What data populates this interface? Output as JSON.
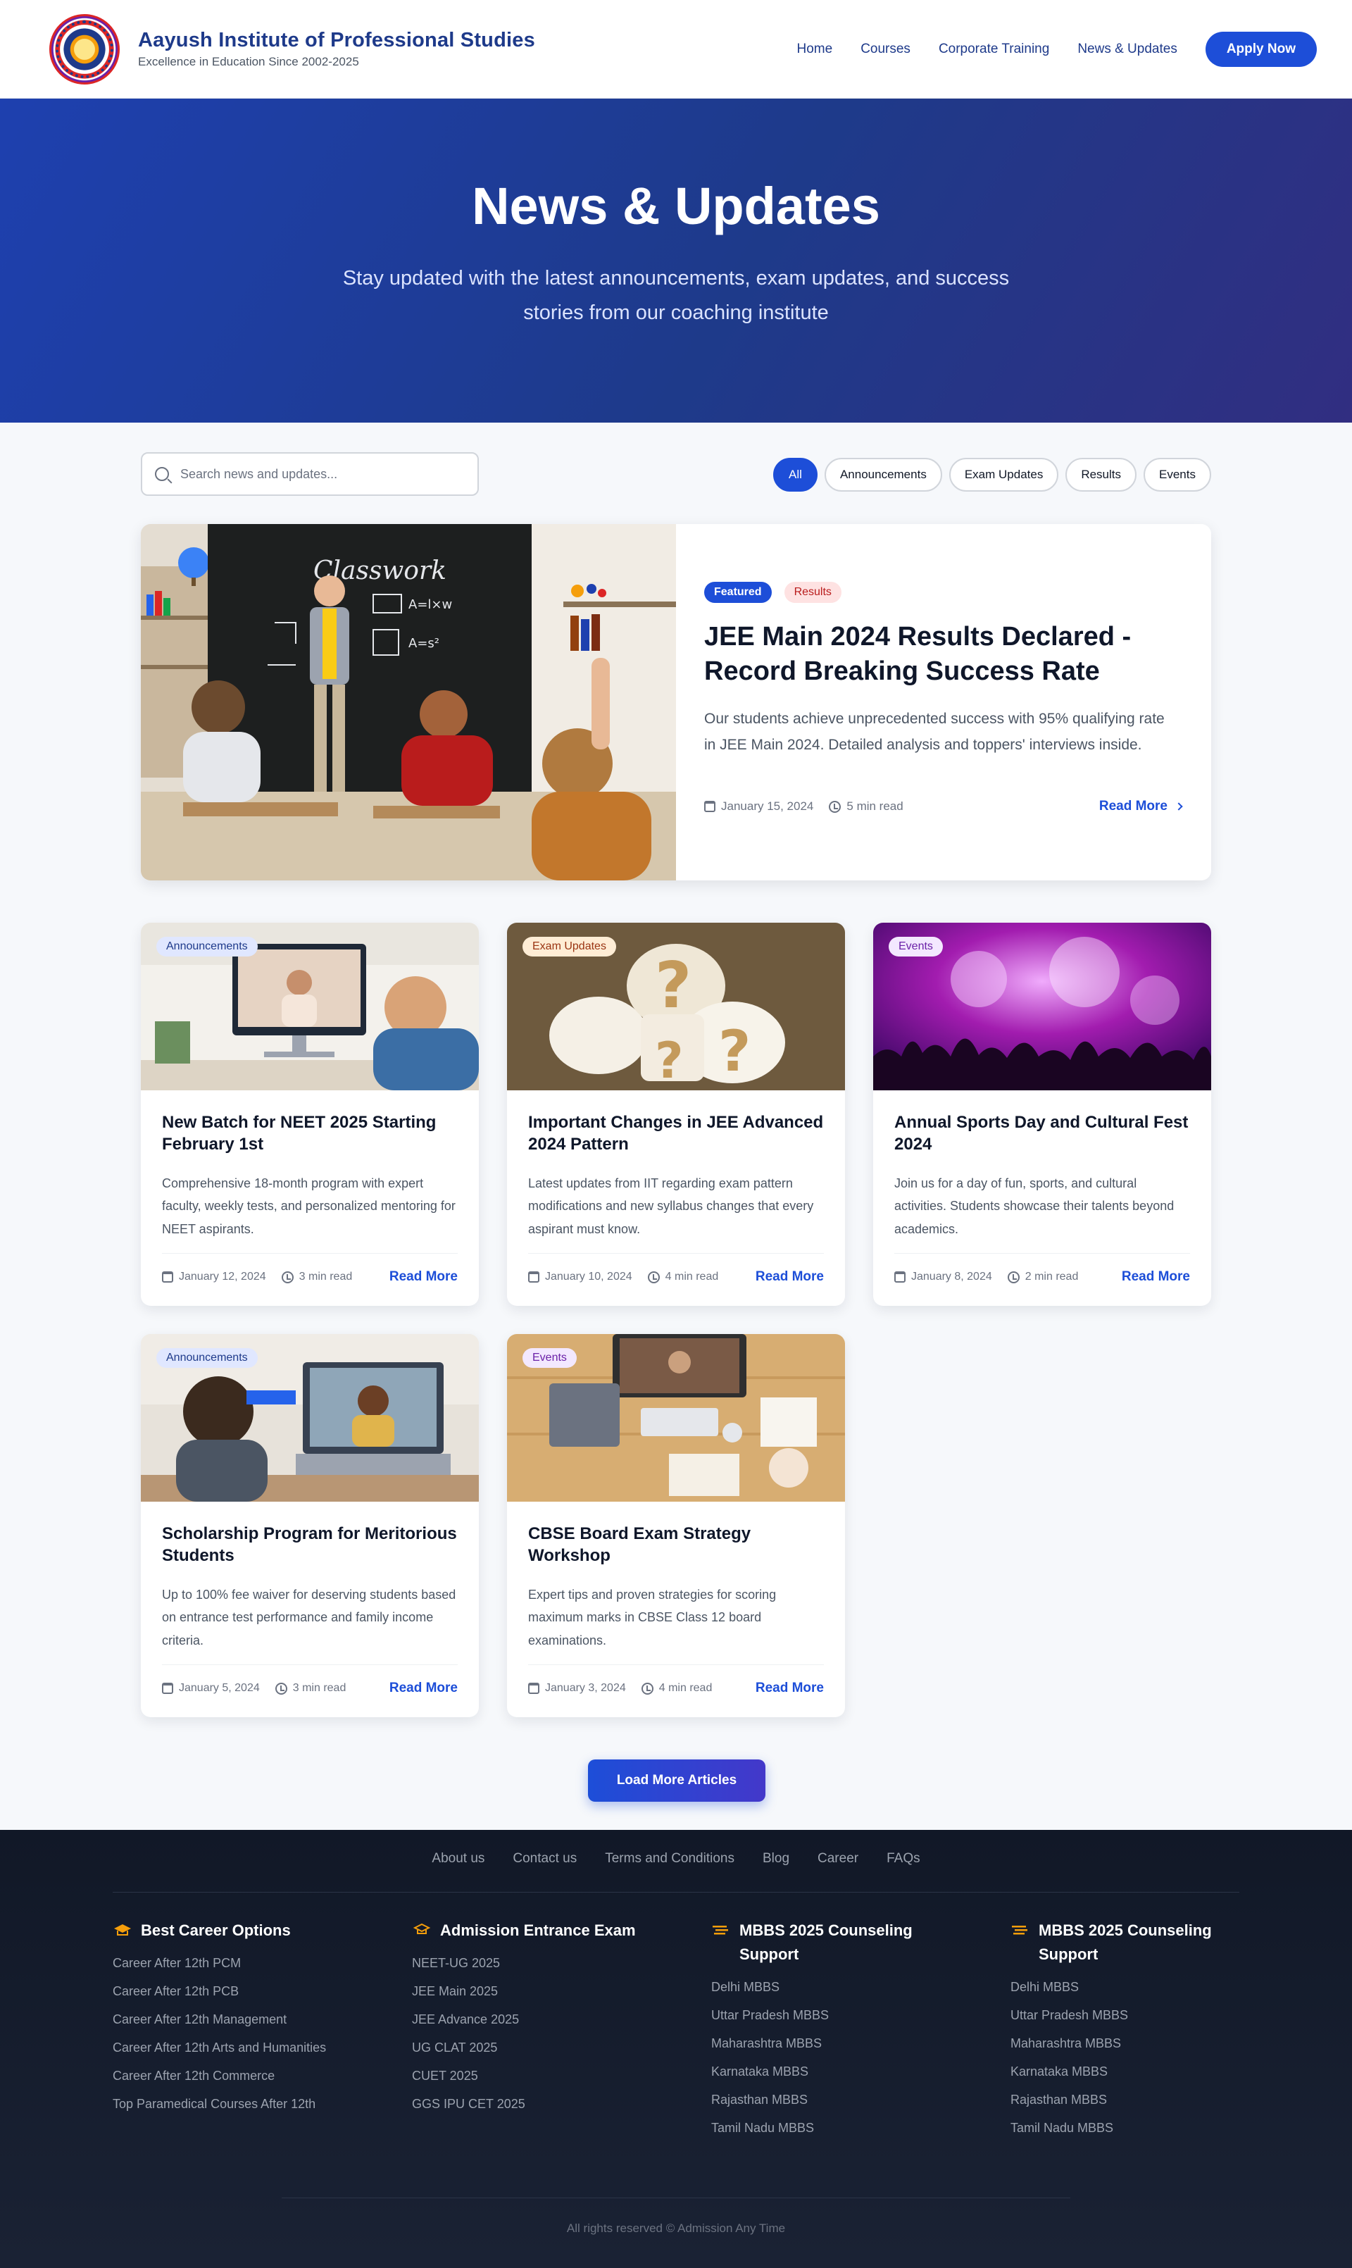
{
  "header": {
    "brand_title": "Aayush Institute of Professional Studies",
    "brand_subtitle": "Excellence in Education Since 2002-2025",
    "nav": [
      "Home",
      "Courses",
      "Corporate Training",
      "News & Updates"
    ],
    "apply_label": "Apply Now"
  },
  "hero": {
    "title": "News & Updates",
    "subtitle": "Stay updated with the latest announcements, exam updates, and success stories from our coaching institute"
  },
  "search": {
    "placeholder": "Search news and updates..."
  },
  "filters": [
    "All",
    "Announcements",
    "Exam Updates",
    "Results",
    "Events"
  ],
  "featured": {
    "badge_featured": "Featured",
    "badge_category": "Results",
    "title": "JEE Main 2024 Results Declared - Record Breaking Success Rate",
    "excerpt": "Our students achieve unprecedented success with 95% qualifying rate in JEE Main 2024. Detailed analysis and toppers' interviews inside.",
    "date": "January 15, 2024",
    "read_time": "5 min read",
    "read_more": "Read More",
    "board_text": "Classwork"
  },
  "articles": [
    {
      "category": "Announcements",
      "title": "New Batch for NEET 2025 Starting February 1st",
      "excerpt": "Comprehensive 18-month program with expert faculty, weekly tests, and personalized mentoring for NEET aspirants.",
      "date": "January 12, 2024",
      "read_time": "3 min read",
      "read_more": "Read More"
    },
    {
      "category": "Exam Updates",
      "title": "Important Changes in JEE Advanced 2024 Pattern",
      "excerpt": "Latest updates from IIT regarding exam pattern modifications and new syllabus changes that every aspirant must know.",
      "date": "January 10, 2024",
      "read_time": "4 min read",
      "read_more": "Read More"
    },
    {
      "category": "Events",
      "title": "Annual Sports Day and Cultural Fest 2024",
      "excerpt": "Join us for a day of fun, sports, and cultural activities. Students showcase their talents beyond academics.",
      "date": "January 8, 2024",
      "read_time": "2 min read",
      "read_more": "Read More"
    },
    {
      "category": "Announcements",
      "title": "Scholarship Program for Meritorious Students",
      "excerpt": "Up to 100% fee waiver for deserving students based on entrance test performance and family income criteria.",
      "date": "January 5, 2024",
      "read_time": "3 min read",
      "read_more": "Read More"
    },
    {
      "category": "Events",
      "title": "CBSE Board Exam Strategy Workshop",
      "excerpt": "Expert tips and proven strategies for scoring maximum marks in CBSE Class 12 board examinations.",
      "date": "January 3, 2024",
      "read_time": "4 min read",
      "read_more": "Read More"
    }
  ],
  "load_more": "Load More Articles",
  "footer": {
    "links": [
      "About us",
      "Contact us",
      "Terms and Conditions",
      "Blog",
      "Career",
      "FAQs"
    ],
    "columns": [
      {
        "icon": "graduation-cap-icon",
        "title": "Best Career Options",
        "items": [
          "Career After 12th PCM",
          "Career After 12th PCB",
          "Career After 12th Management",
          "Career After 12th Arts and Humanities",
          "Career After 12th Commerce",
          "Top Paramedical Courses After 12th"
        ]
      },
      {
        "icon": "cap-icon",
        "title": "Admission Entrance Exam",
        "items": [
          "NEET-UG 2025",
          "JEE Main 2025",
          "JEE Advance 2025",
          "UG CLAT 2025",
          "CUET 2025",
          "GGS IPU CET 2025"
        ]
      },
      {
        "icon": "list-icon",
        "title": "MBBS 2025 Counseling Support",
        "items": [
          "Delhi MBBS",
          "Uttar Pradesh MBBS",
          "Maharashtra MBBS",
          "Karnataka MBBS",
          "Rajasthan MBBS",
          "Tamil Nadu MBBS"
        ]
      },
      {
        "icon": "list-icon",
        "title": "MBBS 2025 Counseling Support",
        "items": [
          "Delhi MBBS",
          "Uttar Pradesh MBBS",
          "Maharashtra MBBS",
          "Karnataka MBBS",
          "Rajasthan MBBS",
          "Tamil Nadu MBBS"
        ]
      }
    ],
    "copyright": "All rights reserved © Admission Any Time"
  },
  "colors": {
    "primary": "#1d4ed8",
    "navy": "#1e3a8a",
    "footer_bg": "#111827",
    "icon_accent": "#f59e0b"
  }
}
